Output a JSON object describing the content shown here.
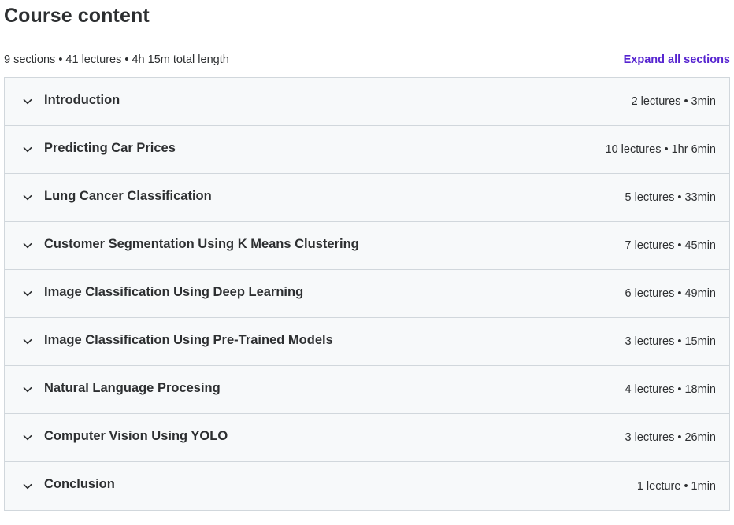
{
  "header": {
    "title": "Course content",
    "summary": "9 sections • 41 lectures • 4h 15m total length",
    "expand_label": "Expand all sections"
  },
  "colors": {
    "accent": "#5624d0",
    "text": "#2d2f31",
    "row_background": "#f7f9fa",
    "border": "#d1d7dc"
  },
  "icons": {
    "section_toggle": "chevron-down-icon"
  },
  "sections": [
    {
      "title": "Introduction",
      "meta": "2 lectures • 3min"
    },
    {
      "title": "Predicting Car Prices",
      "meta": "10 lectures • 1hr 6min"
    },
    {
      "title": "Lung Cancer Classification",
      "meta": "5 lectures • 33min"
    },
    {
      "title": "Customer Segmentation Using K Means Clustering",
      "meta": "7 lectures • 45min"
    },
    {
      "title": "Image Classification Using Deep Learning",
      "meta": "6 lectures • 49min"
    },
    {
      "title": "Image Classification Using Pre-Trained Models",
      "meta": "3 lectures • 15min"
    },
    {
      "title": "Natural Language Procesing",
      "meta": "4 lectures • 18min"
    },
    {
      "title": "Computer Vision Using YOLO",
      "meta": "3 lectures • 26min"
    },
    {
      "title": "Conclusion",
      "meta": "1 lecture • 1min"
    }
  ]
}
